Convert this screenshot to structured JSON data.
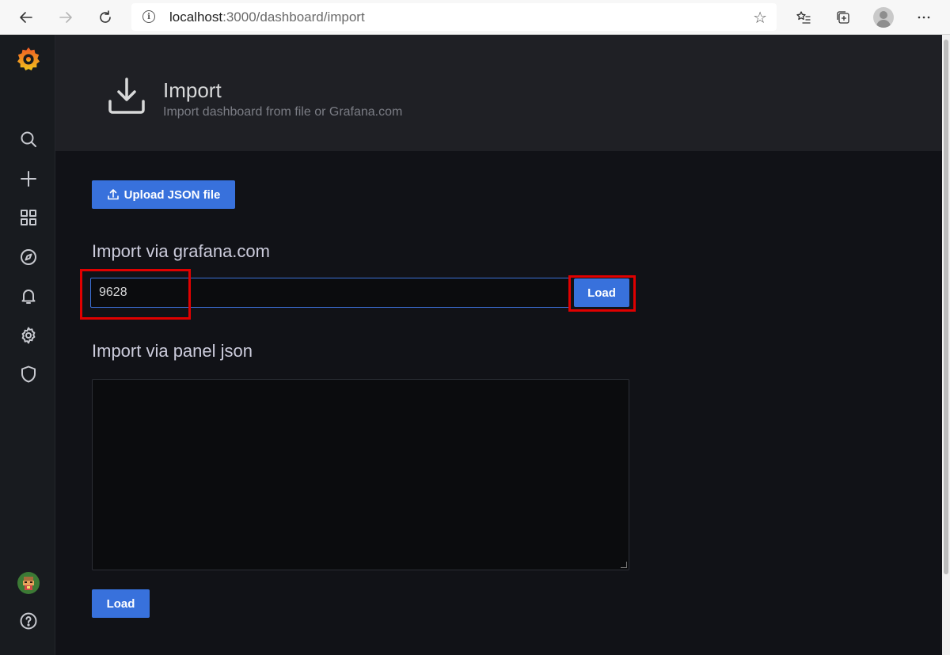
{
  "browser": {
    "url_host": "localhost",
    "url_path": ":3000/dashboard/import"
  },
  "header": {
    "title": "Import",
    "subtitle": "Import dashboard from file or Grafana.com",
    "icon": "import-download-icon"
  },
  "main": {
    "upload_button_label": "Upload JSON file",
    "gcom_section_label": "Import via grafana.com",
    "gcom_input_value": "9628",
    "gcom_load_label": "Load",
    "panel_json_label": "Import via panel json",
    "panel_json_value": "",
    "panel_load_label": "Load"
  },
  "sidebar": {
    "items": [
      {
        "icon": "grafana-logo-icon"
      },
      {
        "icon": "search-icon"
      },
      {
        "icon": "plus-icon"
      },
      {
        "icon": "dashboards-grid-icon"
      },
      {
        "icon": "explore-compass-icon"
      },
      {
        "icon": "alerting-bell-icon"
      },
      {
        "icon": "configuration-gear-icon"
      },
      {
        "icon": "server-admin-shield-icon"
      },
      {
        "icon": "user-avatar-icon"
      },
      {
        "icon": "help-icon"
      }
    ]
  },
  "colors": {
    "accent": "#3871dc",
    "background": "#111217",
    "header_bg": "#1f2025",
    "sidebar_bg": "#181b1f",
    "annotation": "#e00000"
  }
}
